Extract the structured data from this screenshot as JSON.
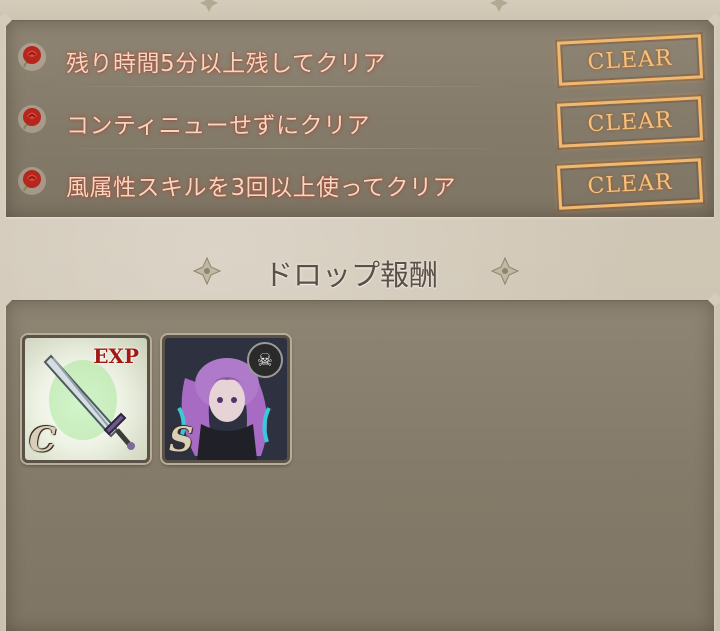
{
  "missions": [
    {
      "text": "残り時間5分以上残してクリア",
      "badge": "CLEAR",
      "icon": "rose-icon"
    },
    {
      "text": "コンティニューせずにクリア",
      "badge": "CLEAR",
      "icon": "rose-icon"
    },
    {
      "text": "風属性スキルを3回以上使ってクリア",
      "badge": "CLEAR",
      "icon": "rose-icon"
    }
  ],
  "drop_section": {
    "title": "ドロップ報酬"
  },
  "rewards": [
    {
      "label": "EXP",
      "rank": "C",
      "icon": "sword-icon"
    },
    {
      "rank": "S",
      "icon": "skull-icon",
      "badge_symbol": "☠"
    }
  ],
  "colors": {
    "mission_text": "#f2d7c6",
    "clear_badge": "#f2b86e",
    "panel": "#857b6a",
    "background": "#cfc5b4"
  }
}
